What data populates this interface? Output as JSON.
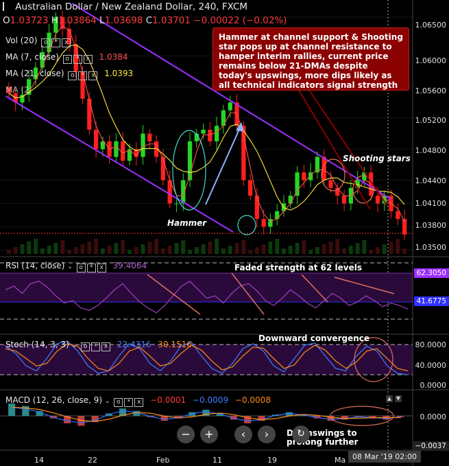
{
  "header": {
    "title": "Australian Dollar / New Zealand Dollar, 240, FXCM",
    "ohlc": [
      {
        "k": "O",
        "v": "1.03723"
      },
      {
        "k": "H",
        "v": "1.03864"
      },
      {
        "k": "L",
        "v": "1.03698"
      },
      {
        "k": "C",
        "v": "1.03701"
      },
      {
        "k": "",
        "v": "−0.00022 (−0.02%)"
      }
    ]
  },
  "indicators": {
    "vol": {
      "label": "Vol (20)"
    },
    "ma7": {
      "label": "MA (7, close)",
      "value": "1.0384",
      "color": "#ff5050"
    },
    "ma21": {
      "label": "MA (21, close)",
      "value": "1.0393",
      "color": "#ffeb3b"
    },
    "ma_extra": {
      "label": "MA (2"
    },
    "rsi": {
      "label": "RSI (14, close)",
      "value": "39.4064"
    },
    "stoch": {
      "label": "Stoch (14, 3, 3)",
      "value1": "22.4316",
      "value2": "30.1516"
    },
    "macd": {
      "label": "MACD (12, 26, close, 9)",
      "v1": "−0.0001",
      "v2": "−0.0009",
      "v3": "−0.0008"
    }
  },
  "annotations": {
    "callout": "Hammer at channel support & Shooting star pops up at channel resistance to hamper interim rallies, current price remains below 21-DMAs despite today's upswings, more dips likely as all technical indicators signal strength",
    "hammer": "Hammer",
    "shooting": "Shooting stars",
    "rsi_note": "Faded strength at 62 levels",
    "stoch_note": "Downward convergence",
    "macd_note": "Downswings to prolong further"
  },
  "price_axis": [
    "1.06500",
    "1.06000",
    "1.05600",
    "1.05200",
    "1.04800",
    "1.04400",
    "1.04100",
    "1.03800",
    "1.03500"
  ],
  "rsi_axis": {
    "upper": "62.3050",
    "lower": "41.6775"
  },
  "stoch_axis": [
    "80.0000",
    "40.0000",
    "0.0000"
  ],
  "macd_axis": {
    "zero": "0.0000",
    "neg": "−0.0037"
  },
  "x_axis": [
    "14",
    "22",
    "Feb",
    "11",
    "19",
    "Ma"
  ],
  "crosshair_date": "08 Mar '19  02:00",
  "controls": {
    "zoom_out": "−",
    "zoom_in": "+",
    "prev": "‹",
    "next": "›",
    "reset": "↻"
  },
  "colors": {
    "up": "#26d626",
    "down": "#ff2020",
    "channel": "#9b30ff",
    "ma7": "#ff5050",
    "ma21": "#ffeb3b",
    "rsi": "#a040c0",
    "stochK": "#3f7fff",
    "stochD": "#ff8c1a",
    "macd": "#2f6fff",
    "signal": "#ff8c1a",
    "callout": "#8b0000"
  },
  "chart_data": [
    {
      "type": "candlestick",
      "title": "Australian Dollar / New Zealand Dollar, 240, FXCM",
      "ylim": [
        1.0345,
        1.0665
      ],
      "x_ticks": [
        "14",
        "22",
        "Feb",
        "11",
        "19",
        "Ma"
      ],
      "series": [
        {
          "name": "AUDNZD",
          "close": [
            1.0552,
            1.054,
            1.055,
            1.057,
            1.0585,
            1.0605,
            1.063,
            1.065,
            1.0635,
            1.0615,
            1.058,
            1.0545,
            1.0505,
            1.048,
            1.049,
            1.047,
            1.049,
            1.0465,
            1.048,
            1.047,
            1.05,
            1.049,
            1.047,
            1.044,
            1.041,
            1.041,
            1.044,
            1.049,
            1.05,
            1.0505,
            1.049,
            1.051,
            1.053,
            1.054,
            1.051,
            1.044,
            1.042,
            1.039,
            1.038,
            1.039,
            1.04,
            1.041,
            1.042,
            1.045,
            1.044,
            1.045,
            1.047,
            1.044,
            1.043,
            1.042,
            1.041,
            1.043,
            1.044,
            1.045,
            1.042,
            1.041,
            1.042,
            1.04,
            1.039,
            1.037
          ]
        }
      ]
    },
    {
      "type": "line",
      "title": "RSI (14, close)",
      "ylim": [
        20,
        80
      ],
      "series": [
        {
          "name": "RSI",
          "values": [
            55,
            58,
            52,
            60,
            62,
            57,
            50,
            44,
            46,
            40,
            38,
            42,
            48,
            55,
            60,
            52,
            45,
            40,
            36,
            42,
            50,
            58,
            62,
            55,
            48,
            50,
            44,
            52,
            58,
            60,
            54,
            46,
            42,
            48,
            55,
            50,
            44,
            40,
            46,
            52,
            48,
            42,
            45,
            50,
            46,
            41,
            44,
            42,
            39
          ]
        }
      ]
    },
    {
      "type": "line",
      "title": "Stoch (14, 3, 3)",
      "ylim": [
        0,
        100
      ],
      "series": [
        {
          "name": "%K",
          "values": [
            80,
            65,
            40,
            30,
            55,
            85,
            90,
            70,
            40,
            25,
            30,
            60,
            85,
            75,
            45,
            30,
            50,
            80,
            88,
            60,
            35,
            25,
            45,
            75,
            85,
            70,
            40,
            28,
            55,
            82,
            86,
            60,
            35,
            30,
            60,
            80,
            70,
            40,
            25,
            22
          ]
        },
        {
          "name": "%D",
          "values": [
            75,
            70,
            55,
            40,
            45,
            70,
            85,
            80,
            55,
            35,
            30,
            45,
            70,
            78,
            60,
            40,
            45,
            65,
            82,
            72,
            50,
            32,
            38,
            60,
            78,
            76,
            55,
            35,
            42,
            68,
            82,
            72,
            50,
            35,
            48,
            70,
            75,
            55,
            35,
            30
          ]
        }
      ]
    },
    {
      "type": "bar",
      "title": "MACD (12, 26, close, 9)",
      "series": [
        {
          "name": "MACD",
          "values": [
            0.001,
            0.0008,
            0.0004,
            -0.0002,
            -0.0006,
            -0.0008,
            -0.0005,
            0.0002,
            0.0006,
            0.0004,
            -0.0001,
            -0.0004,
            -0.0002,
            0.0003,
            0.0005,
            0.0002,
            -0.0003,
            -0.0006,
            -0.0004,
            0.0001,
            0.0003,
            0.0001,
            -0.0002,
            -0.0004,
            -0.0003,
            -0.0001,
            -0.0002,
            -0.0003,
            -0.0001
          ]
        }
      ]
    }
  ]
}
